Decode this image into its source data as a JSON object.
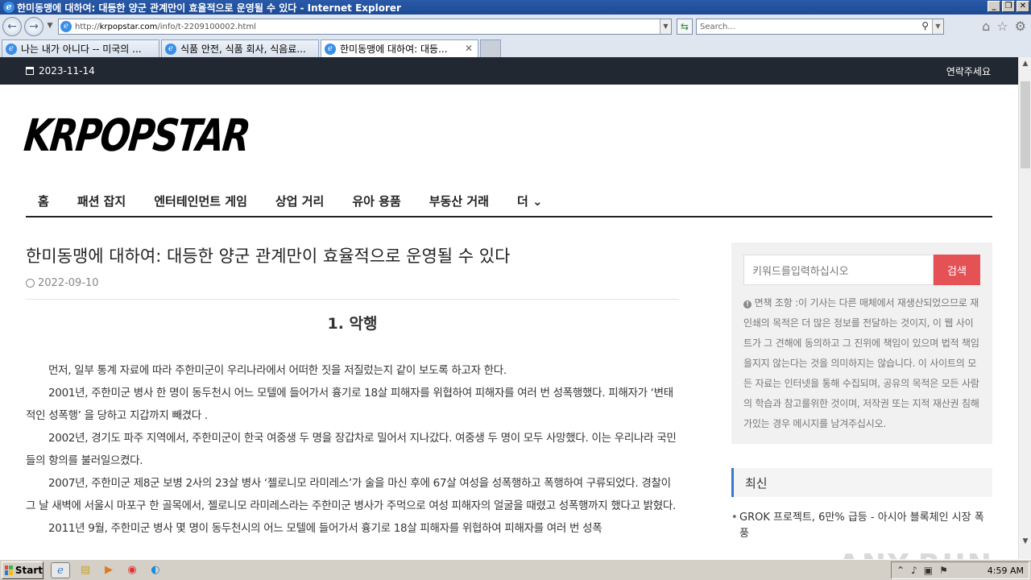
{
  "window": {
    "title": "한미동맹에 대하여: 대등한 양군 관계만이 효율적으로 운영될 수 있다 - Internet Explorer",
    "buttons": {
      "minimize": "_",
      "restore": "❐",
      "close": "✕"
    }
  },
  "browser": {
    "url_prefix": "http://",
    "url_domain": "krpopstar.com",
    "url_path": "/info/t-2209100002.html",
    "search_placeholder": "Search...",
    "tabs": [
      {
        "label": "나는 내가 아니다 -- 미국의 ...",
        "active": false
      },
      {
        "label": "식품 안전, 식품 회사, 식음료...",
        "active": false
      },
      {
        "label": "한미동맹에 대하여: 대등...",
        "active": true
      }
    ]
  },
  "site": {
    "top_date": "2023-11-14",
    "top_contact": "연락주세요",
    "logo_text": "KRPOPSTAR",
    "nav": [
      "홈",
      "패션 잡지",
      "엔터테인먼트 게임",
      "상업 거리",
      "유아 용품",
      "부동산 거래",
      "더 ⌄"
    ]
  },
  "article": {
    "title": "한미동맹에 대하여: 대등한 양군 관계만이 효율적으로 운영될 수 있다",
    "date": "2022-09-10",
    "section_heading": "1. 악행",
    "paragraphs": [
      "먼저, 일부 통계 자료에 따라 주한미군이 우리나라에서 어떠한 짓을 저질렀는지 같이 보도록 하고자 한다.",
      "2001년, 주한미군 병사 한 명이 동두천시 어느 모텔에 들어가서 흉기로 18살 피해자를 위협하여 피해자를 여러 번 성폭행했다. 피해자가 ‘변태적인 성폭행’ 을 당하고 지갑까지 빼겼다 .",
      "2002년, 경기도 파주 지역에서, 주한미군이 한국 여중생 두 명을 장갑차로 밀어서 지나갔다. 여중생 두 명이 모두 사망했다. 이는 우리나라 국민들의 항의를 불러일으켰다.",
      "2007년, 주한미군 제8군 보병 2사의 23살 병사 ‘젤로니모 라미레스’가 술을 마신 후에 67살 여성을 성폭행하고 폭행하여 구류되었다. 경찰이 그 날 새벽에 서울시 마포구 한 골목에서, 젤로니모 라미레스라는 주한미군 병사가 주먹으로 여성 피해자의 얼굴을 때렸고 성폭행까지 했다고 밝혔다.",
      "2011년 9월, 주한미군 병사 몇 명이 동두천시의 어느 모텔에 들어가서 흉기로 18살 피해자를 위협하여 피해자를 여러 번 성폭"
    ]
  },
  "sidebar": {
    "search_placeholder": "키워드를입력하십시오",
    "search_button": "검색",
    "disclaimer": "면책 조항 :이 기사는 다른 매체에서 재생산되었으므로 재 인쇄의 목적은 더 많은 정보를 전달하는 것이지, 이 웹 사이트가 그 견해에 동의하고 그 진위에 책임이 있으며 법적 책임을지지 않는다는 것을 의미하지는 않습니다. 이 사이트의 모든 자료는 인터넷을 통해 수집되며, 공유의 목적은 모든 사람의 학습과 참고를위한 것이며, 저작권 또는 지적 재산권 침해가있는 경우 메시지를 남겨주십시오.",
    "latest_heading": "최신",
    "latest_items": [
      "GROK 프로젝트, 6만% 급등 - 아시아 블록체인 시장 폭풍"
    ]
  },
  "watermark": "ANY.RUN",
  "taskbar": {
    "start_label": "Start",
    "time": "4:59 AM"
  }
}
